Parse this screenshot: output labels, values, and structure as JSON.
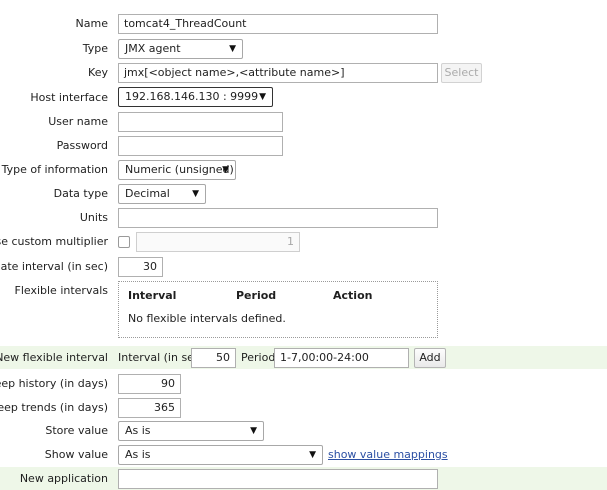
{
  "form": {
    "name": {
      "label": "Name",
      "value": "tomcat4_ThreadCount"
    },
    "type": {
      "label": "Type",
      "value": "JMX agent"
    },
    "key": {
      "label": "Key",
      "value": "jmx[<object name>,<attribute name>]",
      "select_label": "Select"
    },
    "host_interface": {
      "label": "Host interface",
      "value": "192.168.146.130 : 9999"
    },
    "user_name": {
      "label": "User name",
      "value": ""
    },
    "password": {
      "label": "Password",
      "value": ""
    },
    "type_of_information": {
      "label": "Type of information",
      "value": "Numeric (unsigned)"
    },
    "data_type": {
      "label": "Data type",
      "value": "Decimal"
    },
    "units": {
      "label": "Units",
      "value": ""
    },
    "custom_multiplier": {
      "label": "Use custom multiplier",
      "checked": false,
      "value": "1"
    },
    "update_interval": {
      "label": "Update interval (in sec)",
      "value": "30"
    },
    "flexible_intervals": {
      "label": "Flexible intervals",
      "columns": [
        "Interval",
        "Period",
        "Action"
      ],
      "empty_message": "No flexible intervals defined."
    },
    "new_flexible_interval": {
      "label": "New flexible interval",
      "interval_label": "Interval (in sec)",
      "interval_value": "50",
      "period_label": "Period",
      "period_value": "1-7,00:00-24:00",
      "add_label": "Add"
    },
    "keep_history": {
      "label": "Keep history (in days)",
      "value": "90"
    },
    "keep_trends": {
      "label": "Keep trends (in days)",
      "value": "365"
    },
    "store_value": {
      "label": "Store value",
      "value": "As is"
    },
    "show_value": {
      "label": "Show value",
      "value": "As is",
      "link": "show value mappings"
    },
    "new_application": {
      "label": "New application",
      "value": ""
    }
  }
}
